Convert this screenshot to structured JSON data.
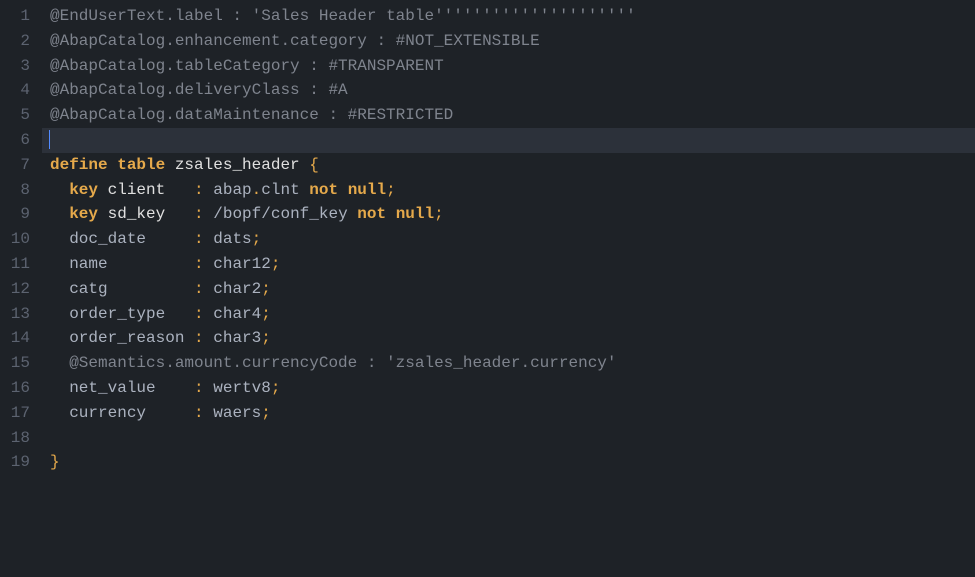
{
  "editor": {
    "highlightedLine": 6,
    "lines": [
      {
        "num": 1,
        "tokens": [
          {
            "t": "@EndUserText.label : ",
            "c": "c-comment"
          },
          {
            "t": "'Sales Header table'''''''''''''''''''''",
            "c": "c-comment"
          }
        ]
      },
      {
        "num": 2,
        "tokens": [
          {
            "t": "@AbapCatalog.enhancement.category : #NOT_EXTENSIBLE",
            "c": "c-comment"
          }
        ]
      },
      {
        "num": 3,
        "tokens": [
          {
            "t": "@AbapCatalog.tableCategory : #TRANSPARENT",
            "c": "c-comment"
          }
        ]
      },
      {
        "num": 4,
        "tokens": [
          {
            "t": "@AbapCatalog.deliveryClass : #A",
            "c": "c-comment"
          }
        ]
      },
      {
        "num": 5,
        "tokens": [
          {
            "t": "@AbapCatalog.dataMaintenance : #RESTRICTED",
            "c": "c-comment"
          }
        ]
      },
      {
        "num": 6,
        "tokens": [],
        "highlight": true,
        "cursor": true
      },
      {
        "num": 7,
        "tokens": [
          {
            "t": "define table",
            "c": "c-keyword"
          },
          {
            "t": " ",
            "c": ""
          },
          {
            "t": "zsales_header",
            "c": "c-white"
          },
          {
            "t": " ",
            "c": ""
          },
          {
            "t": "{",
            "c": "c-keyword2"
          }
        ]
      },
      {
        "num": 8,
        "tokens": [
          {
            "t": "  ",
            "c": ""
          },
          {
            "t": "key",
            "c": "c-keyword"
          },
          {
            "t": " ",
            "c": ""
          },
          {
            "t": "client   ",
            "c": "c-white"
          },
          {
            "t": ": ",
            "c": "c-keyword2"
          },
          {
            "t": "abap",
            "c": "c-ident"
          },
          {
            "t": ".",
            "c": "c-keyword2"
          },
          {
            "t": "clnt",
            "c": "c-ident"
          },
          {
            "t": " ",
            "c": ""
          },
          {
            "t": "not null",
            "c": "c-keyword"
          },
          {
            "t": ";",
            "c": "c-keyword2"
          }
        ]
      },
      {
        "num": 9,
        "tokens": [
          {
            "t": "  ",
            "c": ""
          },
          {
            "t": "key",
            "c": "c-keyword"
          },
          {
            "t": " ",
            "c": ""
          },
          {
            "t": "sd_key   ",
            "c": "c-white"
          },
          {
            "t": ": ",
            "c": "c-keyword2"
          },
          {
            "t": "/bopf/conf_key",
            "c": "c-ident"
          },
          {
            "t": " ",
            "c": ""
          },
          {
            "t": "not null",
            "c": "c-keyword"
          },
          {
            "t": ";",
            "c": "c-keyword2"
          }
        ]
      },
      {
        "num": 10,
        "tokens": [
          {
            "t": "  ",
            "c": ""
          },
          {
            "t": "doc_date     ",
            "c": "c-ident"
          },
          {
            "t": ": ",
            "c": "c-keyword2"
          },
          {
            "t": "dats",
            "c": "c-ident"
          },
          {
            "t": ";",
            "c": "c-keyword2"
          }
        ]
      },
      {
        "num": 11,
        "tokens": [
          {
            "t": "  ",
            "c": ""
          },
          {
            "t": "name         ",
            "c": "c-ident"
          },
          {
            "t": ": ",
            "c": "c-keyword2"
          },
          {
            "t": "char12",
            "c": "c-ident"
          },
          {
            "t": ";",
            "c": "c-keyword2"
          }
        ]
      },
      {
        "num": 12,
        "tokens": [
          {
            "t": "  ",
            "c": ""
          },
          {
            "t": "catg         ",
            "c": "c-ident"
          },
          {
            "t": ": ",
            "c": "c-keyword2"
          },
          {
            "t": "char2",
            "c": "c-ident"
          },
          {
            "t": ";",
            "c": "c-keyword2"
          }
        ]
      },
      {
        "num": 13,
        "tokens": [
          {
            "t": "  ",
            "c": ""
          },
          {
            "t": "order_type   ",
            "c": "c-ident"
          },
          {
            "t": ": ",
            "c": "c-keyword2"
          },
          {
            "t": "char4",
            "c": "c-ident"
          },
          {
            "t": ";",
            "c": "c-keyword2"
          }
        ]
      },
      {
        "num": 14,
        "tokens": [
          {
            "t": "  ",
            "c": ""
          },
          {
            "t": "order_reason ",
            "c": "c-ident"
          },
          {
            "t": ": ",
            "c": "c-keyword2"
          },
          {
            "t": "char3",
            "c": "c-ident"
          },
          {
            "t": ";",
            "c": "c-keyword2"
          }
        ]
      },
      {
        "num": 15,
        "tokens": [
          {
            "t": "  ",
            "c": ""
          },
          {
            "t": "@Semantics.amount.currencyCode : 'zsales_header.currency'",
            "c": "c-comment"
          }
        ]
      },
      {
        "num": 16,
        "tokens": [
          {
            "t": "  ",
            "c": ""
          },
          {
            "t": "net_value    ",
            "c": "c-ident"
          },
          {
            "t": ": ",
            "c": "c-keyword2"
          },
          {
            "t": "wertv8",
            "c": "c-ident"
          },
          {
            "t": ";",
            "c": "c-keyword2"
          }
        ]
      },
      {
        "num": 17,
        "tokens": [
          {
            "t": "  ",
            "c": ""
          },
          {
            "t": "currency     ",
            "c": "c-ident"
          },
          {
            "t": ": ",
            "c": "c-keyword2"
          },
          {
            "t": "waers",
            "c": "c-ident"
          },
          {
            "t": ";",
            "c": "c-keyword2"
          }
        ]
      },
      {
        "num": 18,
        "tokens": []
      },
      {
        "num": 19,
        "tokens": [
          {
            "t": "}",
            "c": "c-keyword2"
          }
        ]
      }
    ]
  }
}
